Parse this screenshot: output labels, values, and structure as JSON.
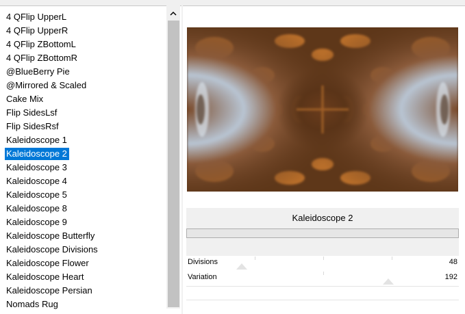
{
  "effects_list": {
    "items": [
      "4 QFlip UpperL",
      "4 QFlip UpperR",
      "4 QFlip ZBottomL",
      "4 QFlip ZBottomR",
      "@BlueBerry Pie",
      "@Mirrored & Scaled",
      "Cake Mix",
      "Flip SidesLsf",
      "Flip SidesRsf",
      "Kaleidoscope 1",
      "Kaleidoscope 2",
      "Kaleidoscope 3",
      "Kaleidoscope 4",
      "Kaleidoscope 5",
      "Kaleidoscope 8",
      "Kaleidoscope 9",
      "Kaleidoscope Butterfly",
      "Kaleidoscope Divisions",
      "Kaleidoscope Flower",
      "Kaleidoscope Heart",
      "Kaleidoscope Persian",
      "Nomads Rug"
    ],
    "selected": "Kaleidoscope 2"
  },
  "scrollbar": {
    "up_icon": "chevron-up-icon"
  },
  "effect_panel": {
    "name": "Kaleidoscope 2",
    "sliders": [
      {
        "label": "Divisions",
        "value": "48",
        "level": 0.19
      },
      {
        "label": "Variation",
        "value": "192",
        "level": 0.75
      }
    ]
  },
  "colors": {
    "selection": "#0078d7",
    "preview_brown": "#5a3418",
    "preview_orange": "#c8782e",
    "preview_blue": "#a9b9cc"
  }
}
